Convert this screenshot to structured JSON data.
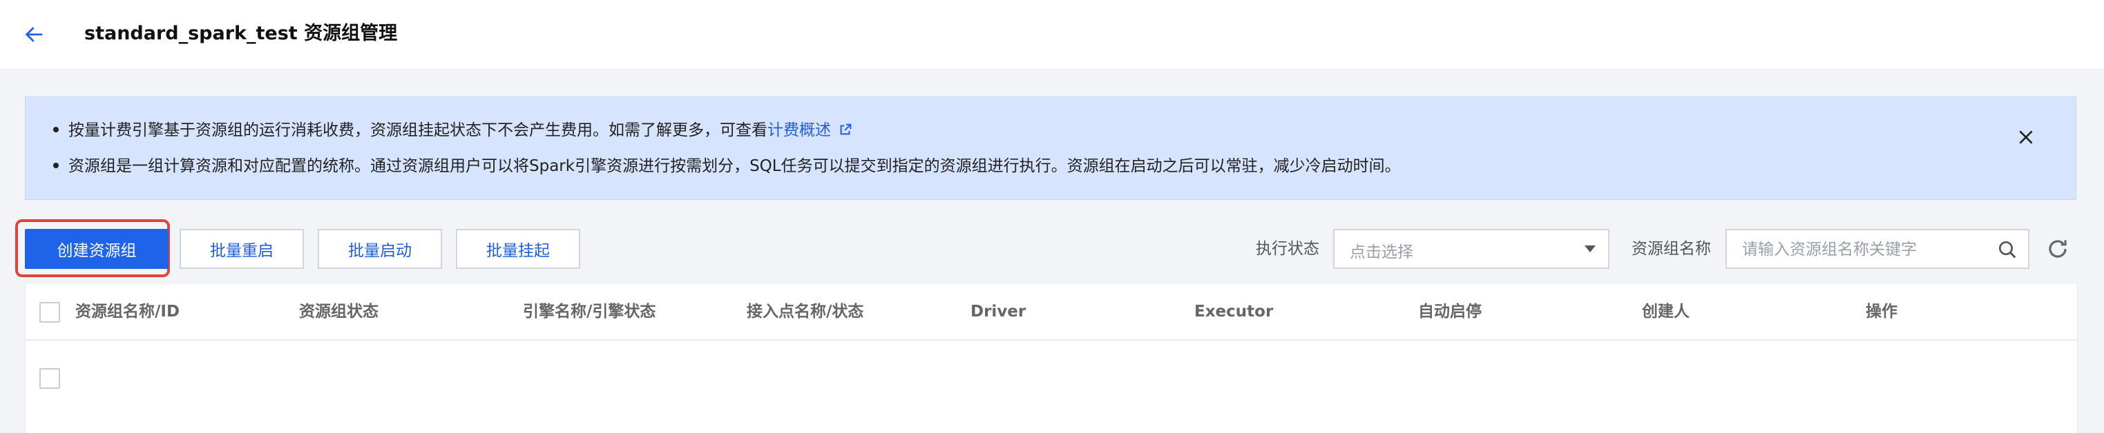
{
  "header": {
    "back_icon": "arrow-left-icon",
    "title": "standard_spark_test 资源组管理"
  },
  "notice": {
    "line1_text": "按量计费引擎基于资源组的运行消耗收费，资源组挂起状态下不会产生费用。如需了解更多，可查看",
    "line1_link": "计费概述",
    "line2_text": "资源组是一组计算资源和对应配置的统称。通过资源组用户可以将Spark引擎资源进行按需划分，SQL任务可以提交到指定的资源组进行执行。资源组在启动之后可以常驻，减少冷启动时间。",
    "colors": {
      "background": "#d6e4fd",
      "link": "#1f5fde"
    }
  },
  "toolbar": {
    "create_label": "创建资源组",
    "batch_restart_label": "批量重启",
    "batch_start_label": "批量启动",
    "batch_suspend_label": "批量挂起"
  },
  "filters": {
    "status_label": "执行状态",
    "status_placeholder": "点击选择",
    "name_label": "资源组名称",
    "name_placeholder": "请输入资源组名称关键字"
  },
  "table": {
    "columns": [
      "资源组名称/ID",
      "资源组状态",
      "引擎名称/引擎状态",
      "接入点名称/状态",
      "Driver",
      "Executor",
      "自动启停",
      "创建人",
      "操作"
    ],
    "rows": []
  },
  "colors": {
    "primary": "#1f63e8",
    "highlight_border": "#e0453a"
  }
}
